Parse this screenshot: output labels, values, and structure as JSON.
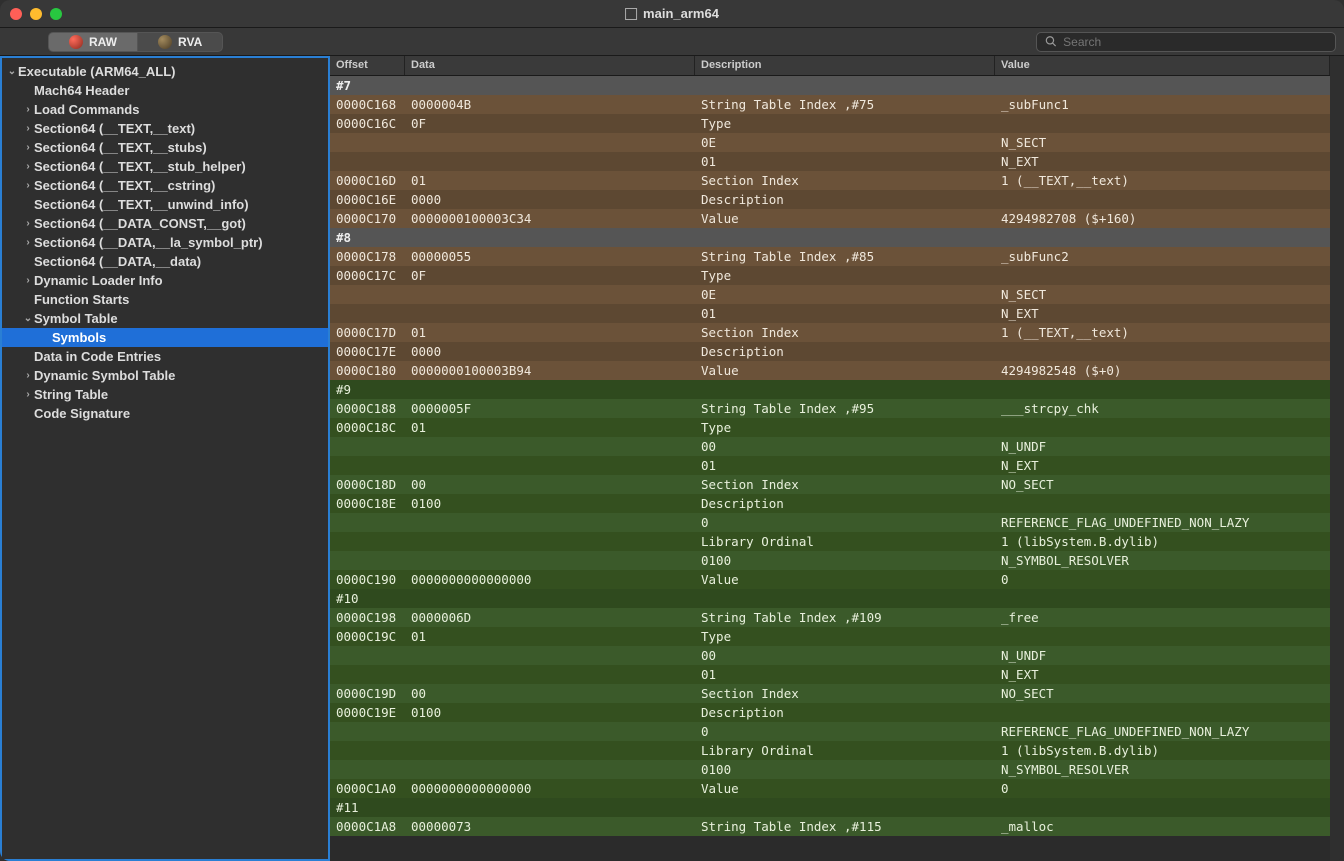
{
  "window": {
    "title": "main_arm64"
  },
  "toolbar": {
    "raw": "RAW",
    "rva": "RVA",
    "search_placeholder": "Search"
  },
  "sidebar": {
    "root": "Executable  (ARM64_ALL)",
    "items": [
      {
        "label": "Mach64 Header",
        "exp": null
      },
      {
        "label": "Load Commands",
        "exp": ">"
      },
      {
        "label": "Section64 (__TEXT,__text)",
        "exp": ">"
      },
      {
        "label": "Section64 (__TEXT,__stubs)",
        "exp": ">"
      },
      {
        "label": "Section64 (__TEXT,__stub_helper)",
        "exp": ">"
      },
      {
        "label": "Section64 (__TEXT,__cstring)",
        "exp": ">"
      },
      {
        "label": "Section64 (__TEXT,__unwind_info)",
        "exp": null
      },
      {
        "label": "Section64 (__DATA_CONST,__got)",
        "exp": ">"
      },
      {
        "label": "Section64 (__DATA,__la_symbol_ptr)",
        "exp": ">"
      },
      {
        "label": "Section64 (__DATA,__data)",
        "exp": null
      },
      {
        "label": "Dynamic Loader Info",
        "exp": ">"
      },
      {
        "label": "Function Starts",
        "exp": null
      },
      {
        "label": "Symbol Table",
        "exp": "v",
        "children": [
          {
            "label": "Symbols",
            "selected": true
          }
        ]
      },
      {
        "label": "Data in Code Entries",
        "exp": null
      },
      {
        "label": "Dynamic Symbol Table",
        "exp": ">"
      },
      {
        "label": "String Table",
        "exp": ">"
      },
      {
        "label": "Code Signature",
        "exp": null
      }
    ]
  },
  "columns": {
    "offset": "Offset",
    "data": "Data",
    "desc": "Description",
    "value": "Value"
  },
  "rows": [
    {
      "t": "h",
      "offset": "#7"
    },
    {
      "t": "b",
      "alt": 0,
      "offset": "0000C168",
      "data": "0000004B",
      "desc": "String Table Index ,#75",
      "value": "_subFunc1"
    },
    {
      "t": "b",
      "alt": 1,
      "offset": "0000C16C",
      "data": "0F",
      "desc": "Type",
      "value": ""
    },
    {
      "t": "b",
      "alt": 0,
      "offset": "",
      "data": "",
      "desc": "0E",
      "value": "N_SECT"
    },
    {
      "t": "b",
      "alt": 1,
      "offset": "",
      "data": "",
      "desc": "01",
      "value": "N_EXT"
    },
    {
      "t": "b",
      "alt": 0,
      "offset": "0000C16D",
      "data": "01",
      "desc": "Section Index",
      "value": "1 (__TEXT,__text)"
    },
    {
      "t": "b",
      "alt": 1,
      "offset": "0000C16E",
      "data": "0000",
      "desc": "Description",
      "value": ""
    },
    {
      "t": "b",
      "alt": 0,
      "offset": "0000C170",
      "data": "0000000100003C34",
      "desc": "Value",
      "value": "4294982708 ($+160)"
    },
    {
      "t": "h",
      "offset": "#8"
    },
    {
      "t": "b",
      "alt": 0,
      "offset": "0000C178",
      "data": "00000055",
      "desc": "String Table Index ,#85",
      "value": "_subFunc2"
    },
    {
      "t": "b",
      "alt": 1,
      "offset": "0000C17C",
      "data": "0F",
      "desc": "Type",
      "value": ""
    },
    {
      "t": "b",
      "alt": 0,
      "offset": "",
      "data": "",
      "desc": "0E",
      "value": "N_SECT"
    },
    {
      "t": "b",
      "alt": 1,
      "offset": "",
      "data": "",
      "desc": "01",
      "value": "N_EXT"
    },
    {
      "t": "b",
      "alt": 0,
      "offset": "0000C17D",
      "data": "01",
      "desc": "Section Index",
      "value": "1 (__TEXT,__text)"
    },
    {
      "t": "b",
      "alt": 1,
      "offset": "0000C17E",
      "data": "0000",
      "desc": "Description",
      "value": ""
    },
    {
      "t": "b",
      "alt": 0,
      "offset": "0000C180",
      "data": "0000000100003B94",
      "desc": "Value",
      "value": "4294982548 ($+0)"
    },
    {
      "t": "h2",
      "offset": "#9"
    },
    {
      "t": "g",
      "alt": 0,
      "offset": "0000C188",
      "data": "0000005F",
      "desc": "String Table Index ,#95",
      "value": "___strcpy_chk"
    },
    {
      "t": "g",
      "alt": 1,
      "offset": "0000C18C",
      "data": "01",
      "desc": "Type",
      "value": ""
    },
    {
      "t": "g",
      "alt": 0,
      "offset": "",
      "data": "",
      "desc": "00",
      "value": "N_UNDF"
    },
    {
      "t": "g",
      "alt": 1,
      "offset": "",
      "data": "",
      "desc": "01",
      "value": "N_EXT"
    },
    {
      "t": "g",
      "alt": 0,
      "offset": "0000C18D",
      "data": "00",
      "desc": "Section Index",
      "value": "NO_SECT"
    },
    {
      "t": "g",
      "alt": 1,
      "offset": "0000C18E",
      "data": "0100",
      "desc": "Description",
      "value": ""
    },
    {
      "t": "g",
      "alt": 0,
      "offset": "",
      "data": "",
      "desc": "0",
      "value": "REFERENCE_FLAG_UNDEFINED_NON_LAZY"
    },
    {
      "t": "g",
      "alt": 1,
      "offset": "",
      "data": "",
      "desc": "Library Ordinal",
      "value": "1 (libSystem.B.dylib)"
    },
    {
      "t": "g",
      "alt": 0,
      "offset": "",
      "data": "",
      "desc": "0100",
      "value": "N_SYMBOL_RESOLVER"
    },
    {
      "t": "g",
      "alt": 1,
      "offset": "0000C190",
      "data": "0000000000000000",
      "desc": "Value",
      "value": "0"
    },
    {
      "t": "h2",
      "offset": "#10"
    },
    {
      "t": "g",
      "alt": 0,
      "offset": "0000C198",
      "data": "0000006D",
      "desc": "String Table Index ,#109",
      "value": "_free"
    },
    {
      "t": "g",
      "alt": 1,
      "offset": "0000C19C",
      "data": "01",
      "desc": "Type",
      "value": ""
    },
    {
      "t": "g",
      "alt": 0,
      "offset": "",
      "data": "",
      "desc": "00",
      "value": "N_UNDF"
    },
    {
      "t": "g",
      "alt": 1,
      "offset": "",
      "data": "",
      "desc": "01",
      "value": "N_EXT"
    },
    {
      "t": "g",
      "alt": 0,
      "offset": "0000C19D",
      "data": "00",
      "desc": "Section Index",
      "value": "NO_SECT"
    },
    {
      "t": "g",
      "alt": 1,
      "offset": "0000C19E",
      "data": "0100",
      "desc": "Description",
      "value": ""
    },
    {
      "t": "g",
      "alt": 0,
      "offset": "",
      "data": "",
      "desc": "0",
      "value": "REFERENCE_FLAG_UNDEFINED_NON_LAZY"
    },
    {
      "t": "g",
      "alt": 1,
      "offset": "",
      "data": "",
      "desc": "Library Ordinal",
      "value": "1 (libSystem.B.dylib)"
    },
    {
      "t": "g",
      "alt": 0,
      "offset": "",
      "data": "",
      "desc": "0100",
      "value": "N_SYMBOL_RESOLVER"
    },
    {
      "t": "g",
      "alt": 1,
      "offset": "0000C1A0",
      "data": "0000000000000000",
      "desc": "Value",
      "value": "0"
    },
    {
      "t": "h2",
      "offset": "#11"
    },
    {
      "t": "g",
      "alt": 0,
      "offset": "0000C1A8",
      "data": "00000073",
      "desc": "String Table Index ,#115",
      "value": "_malloc"
    }
  ]
}
